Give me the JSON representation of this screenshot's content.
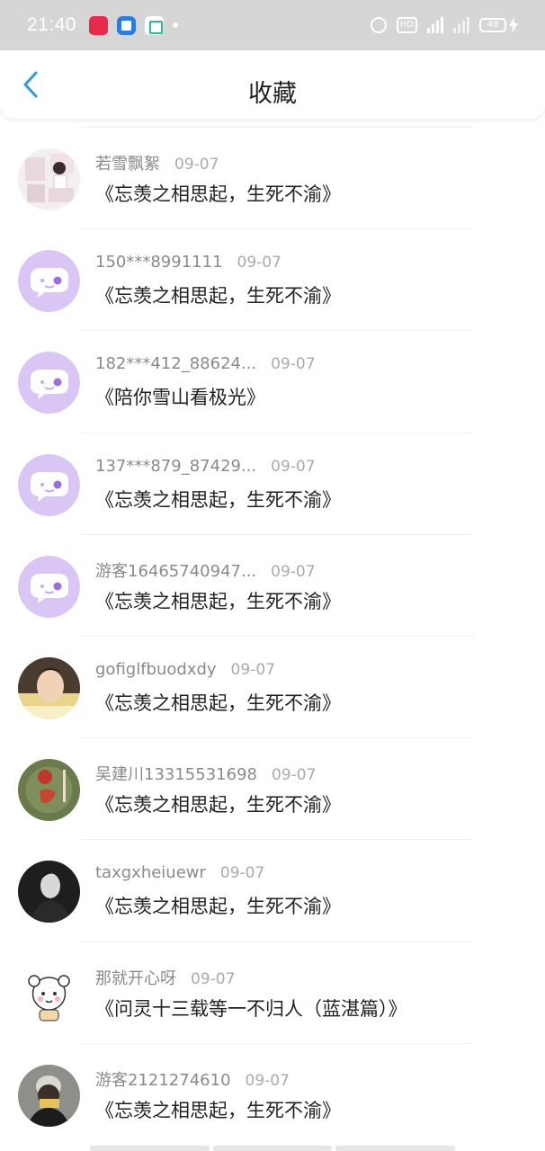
{
  "status_bar": {
    "time": "21:40",
    "battery": "48",
    "network": "4G"
  },
  "header": {
    "title": "收藏"
  },
  "favorites": [
    {
      "user": "若雪飘絮",
      "date": "09-07",
      "title": "《忘羡之相思起，生死不渝》",
      "avatar": "photo-girl"
    },
    {
      "user": "150***8991111",
      "date": "09-07",
      "title": "《忘羡之相思起，生死不渝》",
      "avatar": "default-chat-bubble"
    },
    {
      "user": "182***412_88624...",
      "date": "09-07",
      "title": "《陪你雪山看极光》",
      "avatar": "default-chat-bubble"
    },
    {
      "user": "137***879_87429...",
      "date": "09-07",
      "title": "《忘羡之相思起，生死不渝》",
      "avatar": "default-chat-bubble"
    },
    {
      "user": "游客16465740947...",
      "date": "09-07",
      "title": "《忘羡之相思起，生死不渝》",
      "avatar": "default-chat-bubble"
    },
    {
      "user": "gofiglfbuodxdy",
      "date": "09-07",
      "title": "《忘羡之相思起，生死不渝》",
      "avatar": "photo-boy"
    },
    {
      "user": "吴建川13315531698",
      "date": "09-07",
      "title": "《忘羡之相思起，生死不渝》",
      "avatar": "photo-calligraphy"
    },
    {
      "user": "taxgxheiuewr",
      "date": "09-07",
      "title": "《忘羡之相思起，生死不渝》",
      "avatar": "photo-dark-portrait"
    },
    {
      "user": "那就开心呀",
      "date": "09-07",
      "title": "《问灵十三载等一不归人（蓝湛篇）》",
      "avatar": "cartoon-character"
    },
    {
      "user": "游客2121274610",
      "date": "09-07",
      "title": "《忘羡之相思起，生死不渝》",
      "avatar": "photo-masked"
    }
  ],
  "colors": {
    "accent": "#2f9ae0",
    "default_avatar": "#d9c6f4",
    "status_bar": "#d6d6d6"
  }
}
